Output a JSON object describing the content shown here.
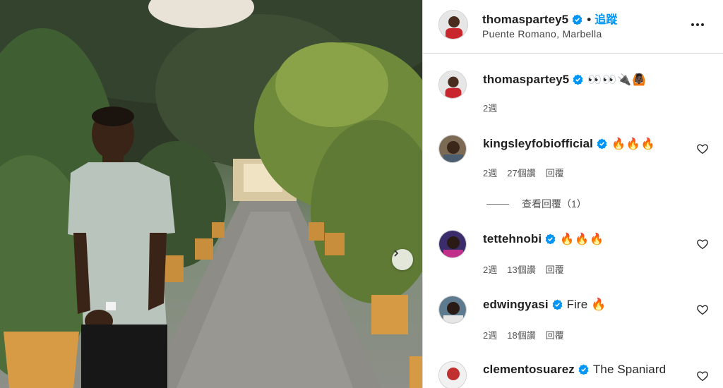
{
  "post": {
    "username": "thomaspartey5",
    "follow_label": "追蹤",
    "location": "Puente Romano, Marbella",
    "caption_emojis": "👀👀🔌🙆🏿"
  },
  "comments": [
    {
      "username": "kingsleyfobiofficial",
      "text": "🔥🔥🔥",
      "time": "2週",
      "likes": "27個讚",
      "reply": "回覆",
      "view_replies": "查看回覆（1）"
    },
    {
      "username": "tettehnobi",
      "text": "🔥🔥🔥",
      "time": "2週",
      "likes": "13個讚",
      "reply": "回覆"
    },
    {
      "username": "edwingyasi",
      "text": "Fire 🔥",
      "time": "2週",
      "likes": "18個讚",
      "reply": "回覆"
    },
    {
      "username": "clementosuarez",
      "text": "The Spaniard"
    }
  ],
  "caption_time": "2週",
  "icons": {
    "verified": "verified-badge-icon",
    "more": "more-options-icon",
    "heart": "heart-outline-icon",
    "next": "chevron-right-icon"
  },
  "colors": {
    "accent": "#0095f6",
    "verified": "#0095f6",
    "text": "#262626",
    "muted": "#555555"
  }
}
